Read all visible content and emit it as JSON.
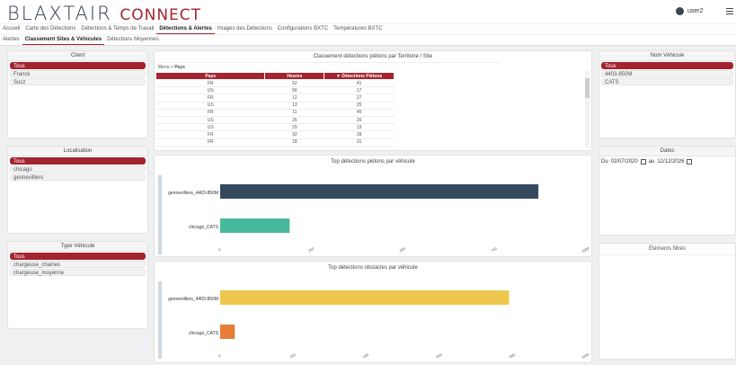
{
  "app": {
    "logo_main": "BLAXTAIR",
    "logo_sub": "CONNECT",
    "user": "user2"
  },
  "nav1": [
    "Accueil",
    "Carte des Détections",
    "Détections & Temps de Travail",
    "Détections & Alertes",
    "Images des Détections",
    "Configurations BXTC",
    "Températures BXTC"
  ],
  "nav2": [
    "Alertes",
    "Classement Sites & Véhicules",
    "Détections Moyennes"
  ],
  "filters": {
    "client": {
      "title": "Client",
      "items": [
        "Tous",
        "Franck",
        "Sucz"
      ]
    },
    "localisation": {
      "title": "Localisation",
      "items": [
        "Tous",
        "chicago",
        "gennevilliers"
      ]
    },
    "type_vehicule": {
      "title": "Type Véhicule",
      "items": [
        "Tous",
        "chargeuse_chaines",
        "chargeuse_moyenne"
      ]
    },
    "nom_vehicule": {
      "title": "Nom Véhicule",
      "items": [
        "Tous",
        "4403-850M",
        "CATS"
      ]
    },
    "dates": {
      "title": "Dates",
      "from_label": "Du",
      "from": "02/07/2020",
      "to_label": "au",
      "to": "12/12/2026"
    },
    "elements": {
      "title": "Éléments filtrés"
    }
  },
  "table": {
    "title": "Classement détections piétons par Territoire / Site",
    "breadcrumb_root": "Menu",
    "breadcrumb_sep": ">",
    "breadcrumb_current": "Pays",
    "columns": [
      "Pays",
      "Heures",
      "Détections Piétons"
    ],
    "rows": [
      [
        "FR",
        "52",
        "41"
      ],
      [
        "US",
        "56",
        "17"
      ],
      [
        "FR",
        "12",
        "27"
      ],
      [
        "US",
        "13",
        "25"
      ],
      [
        "FR",
        "11",
        "45"
      ],
      [
        "US",
        "26",
        "26"
      ],
      [
        "US",
        "29",
        "19"
      ],
      [
        "FR",
        "92",
        "28"
      ],
      [
        "FR",
        "18",
        "31"
      ]
    ]
  },
  "chart_data": [
    {
      "type": "bar",
      "title": "Top détections piétons par véhicule",
      "categories": [
        "gennevilliers_4403-850M",
        "chicago_CATS"
      ],
      "values": [
        870,
        190
      ],
      "colors": [
        "#34495e",
        "#48b89a"
      ],
      "xlim": [
        0,
        1000
      ],
      "ticks": [
        "0",
        "250",
        "500",
        "750",
        "1000"
      ]
    },
    {
      "type": "bar",
      "title": "Top détections obstacles par véhicule",
      "categories": [
        "gennevilliers_4403-850M",
        "chicago_CATS"
      ],
      "values": [
        790,
        40
      ],
      "colors": [
        "#eec84e",
        "#e67e3a"
      ],
      "xlim": [
        0,
        1000
      ],
      "ticks": [
        "0",
        "200",
        "400",
        "600",
        "800",
        "1000"
      ]
    }
  ]
}
